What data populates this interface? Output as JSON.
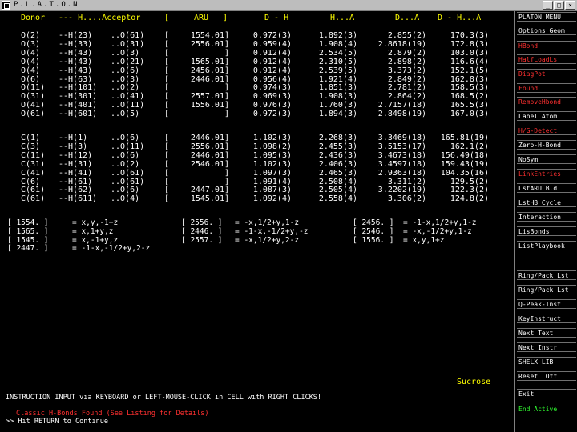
{
  "window": {
    "title": "P.L.A.T.O.N"
  },
  "table": {
    "headers": [
      "Donor",
      "--- H....Acceptor",
      "[",
      "ARU",
      "]",
      "D - H",
      "H...A",
      "D...A",
      "D - H...A"
    ],
    "rows": [
      [
        "O(2)",
        "--H(23)",
        "..O(61)",
        "[",
        "1554.01]",
        "0.972(3)",
        "1.892(3)",
        "2.855(2)",
        "170.3(3)"
      ],
      [
        "O(3)",
        "--H(33)",
        "..O(31)",
        "[",
        "2556.01]",
        "0.959(4)",
        "1.908(4)",
        "2.8618(19)",
        "172.8(3)"
      ],
      [
        "O(4)",
        "--H(43)",
        "..O(3)",
        "[",
        "]",
        "0.912(4)",
        "2.534(5)",
        "2.879(2)",
        "103.0(3)"
      ],
      [
        "O(4)",
        "--H(43)",
        "..O(21)",
        "[",
        "1565.01]",
        "0.912(4)",
        "2.310(5)",
        "2.898(2)",
        "116.6(4)"
      ],
      [
        "O(4)",
        "--H(43)",
        "..O(6)",
        "[",
        "2456.01]",
        "0.912(4)",
        "2.539(5)",
        "3.373(2)",
        "152.1(5)"
      ],
      [
        "O(6)",
        "--H(63)",
        "..O(3)",
        "[",
        "2446.01]",
        "0.956(4)",
        "1.921(4)",
        "2.849(2)",
        "162.8(3)"
      ],
      [
        "O(11)",
        "--H(101)",
        "..O(2)",
        "[",
        "]",
        "0.974(3)",
        "1.851(3)",
        "2.781(2)",
        "158.5(3)"
      ],
      [
        "O(31)",
        "--H(301)",
        "..O(41)",
        "[",
        "2557.01]",
        "0.969(3)",
        "1.908(3)",
        "2.864(2)",
        "168.5(2)"
      ],
      [
        "O(41)",
        "--H(401)",
        "..O(11)",
        "[",
        "1556.01]",
        "0.976(3)",
        "1.760(3)",
        "2.7157(18)",
        "165.5(3)"
      ],
      [
        "O(61)",
        "--H(601)",
        "..O(5)",
        "[",
        "]",
        "0.972(3)",
        "1.894(3)",
        "2.8498(19)",
        "167.0(3)"
      ],
      [
        "C(1)",
        "--H(1)",
        "..O(6)",
        "[",
        "2446.01]",
        "1.102(3)",
        "2.268(3)",
        "3.3469(18)",
        "165.81(19)"
      ],
      [
        "C(3)",
        "--H(3)",
        "..O(11)",
        "[",
        "2556.01]",
        "1.098(2)",
        "2.455(3)",
        "3.5153(17)",
        "162.1(2)"
      ],
      [
        "C(11)",
        "--H(12)",
        "..O(6)",
        "[",
        "2446.01]",
        "1.095(3)",
        "2.436(3)",
        "3.4673(18)",
        "156.49(18)"
      ],
      [
        "C(31)",
        "--H(31)",
        "..O(2)",
        "[",
        "2546.01]",
        "1.102(3)",
        "2.406(3)",
        "3.4597(18)",
        "159.43(19)"
      ],
      [
        "C(41)",
        "--H(41)",
        "..O(61)",
        "[",
        "]",
        "1.097(3)",
        "2.465(3)",
        "2.9363(18)",
        "104.35(16)"
      ],
      [
        "C(6)",
        "--H(61)",
        "..O(61)",
        "[",
        "]",
        "1.091(4)",
        "2.508(4)",
        "3.311(2)",
        "129.5(2)"
      ],
      [
        "C(61)",
        "--H(62)",
        "..O(6)",
        "[",
        "2447.01]",
        "1.087(3)",
        "2.505(4)",
        "3.2202(19)",
        "122.3(2)"
      ],
      [
        "C(61)",
        "--H(611)",
        "..O(4)",
        "[",
        "1545.01]",
        "1.092(4)",
        "2.558(4)",
        "3.306(2)",
        "124.8(2)"
      ]
    ]
  },
  "symmetry": [
    [
      "[ 1554. ]",
      "= x,y,-1+z",
      "[ 2556. ]",
      "= -x,1/2+y,1-z",
      "[ 2456. ]",
      "= -1-x,1/2+y,1-z"
    ],
    [
      "[ 1565. ]",
      "= x,1+y,z",
      "[ 2446. ]",
      "= -1-x,-1/2+y,-z",
      "[ 2546. ]",
      "= -x,-1/2+y,1-z"
    ],
    [
      "[ 1545. ]",
      "= x,-1+y,z",
      "[ 2557. ]",
      "= -x,1/2+y,2-z",
      "[ 1556. ]",
      "= x,y,1+z"
    ],
    [
      "[ 2447. ]",
      "= -1-x,-1/2+y,2-z",
      "",
      "",
      "",
      ""
    ]
  ],
  "compound": "Sucrose",
  "instruction": "INSTRUCTION INPUT via KEYBOARD or LEFT-MOUSE-CLICK in CELL with RIGHT CLICKS!",
  "warning": "Classic H-Bonds Found (See Listing for Details)",
  "prompt": ">> Hit RETURN to Continue",
  "sidebar": [
    {
      "label": "PLATON MENU",
      "color": "white"
    },
    {
      "label": "Options Geom",
      "color": "white"
    },
    {
      "label": "HBond",
      "color": "red"
    },
    {
      "label": "HalfLoadLs",
      "color": "red"
    },
    {
      "label": "DiagPot",
      "color": "red"
    },
    {
      "label": "Found",
      "color": "red"
    },
    {
      "label": "RemoveHbond",
      "color": "red"
    },
    {
      "label": "Label Atom",
      "color": "white"
    },
    {
      "label": "H/G-Detect",
      "color": "red"
    },
    {
      "label": "Zero-H-Bond",
      "color": "white"
    },
    {
      "label": "NoSym",
      "color": "white"
    },
    {
      "label": "LinkEntries",
      "color": "red"
    },
    {
      "label": "LstARU Bld",
      "color": "white"
    },
    {
      "label": "LstHB Cycle",
      "color": "white"
    },
    {
      "label": "Interaction",
      "color": "white"
    },
    {
      "label": "LisBonds",
      "color": "white"
    },
    {
      "label": "ListPlaybook",
      "color": "white"
    },
    {
      "label": "Ring/Pack Lst",
      "color": "white"
    },
    {
      "label": "Ring/Pack Lst",
      "color": "white"
    },
    {
      "label": "Q-Peak-Inst",
      "color": "white"
    },
    {
      "label": "KeyInstruct",
      "color": "white"
    },
    {
      "label": "Next Text",
      "color": "white"
    },
    {
      "label": "Next Instr",
      "color": "white"
    },
    {
      "label": "SHELX LIB",
      "color": "white"
    },
    {
      "label": "Reset  Off",
      "color": "white"
    },
    {
      "label": "Exit",
      "color": "white"
    },
    {
      "label": "End Active",
      "color": "green"
    }
  ]
}
